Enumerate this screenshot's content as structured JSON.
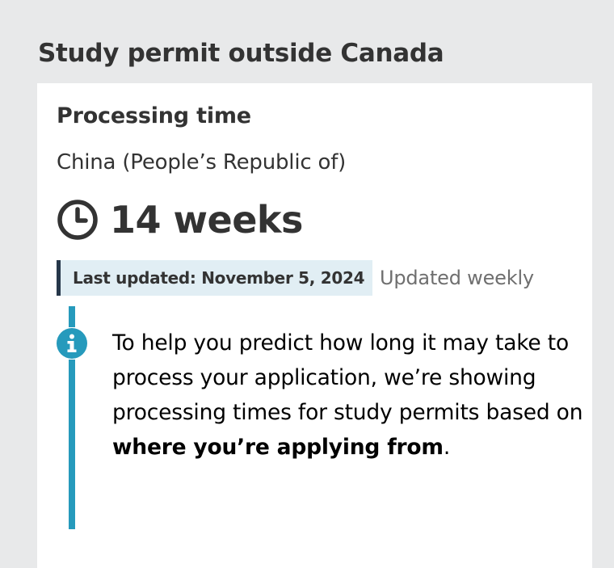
{
  "page": {
    "title": "Study permit outside Canada"
  },
  "processing": {
    "heading": "Processing time",
    "country": "China (People’s Republic of)",
    "duration": "14 weeks",
    "duration_icon": "clock-icon",
    "last_updated": "Last updated: November 5, 2024",
    "update_frequency": "Updated weekly"
  },
  "info": {
    "icon": "info-icon",
    "text_before": "To help you predict how long it may take to process your application, we’re showing processing times for study permits based on ",
    "text_emphasis": "where you’re applying from",
    "text_after": "."
  },
  "colors": {
    "page_background": "#e8e9ea",
    "card_background": "#ffffff",
    "text": "#333333",
    "badge_background": "#e1eef4",
    "badge_border": "#26374a",
    "info_accent": "#269abc",
    "muted_text": "#6f6f6f"
  }
}
